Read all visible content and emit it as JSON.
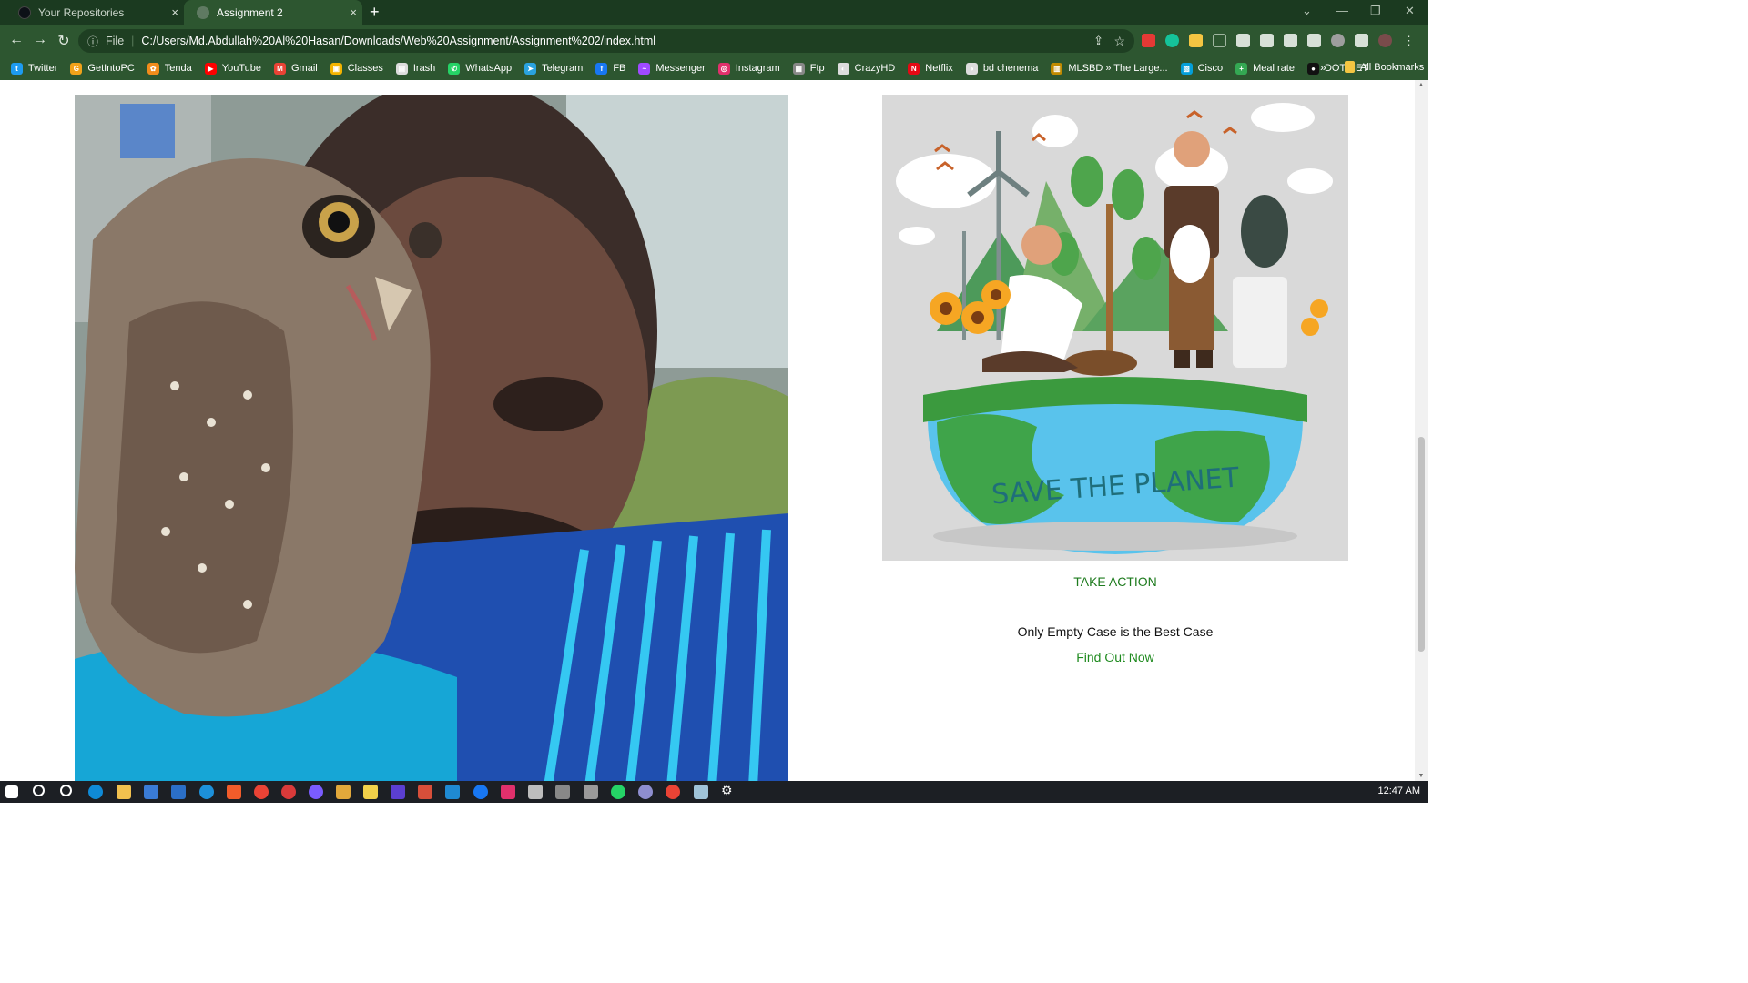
{
  "browser": {
    "tabs": [
      {
        "title": "Your Repositories",
        "active": false,
        "icon": "github-icon"
      },
      {
        "title": "Assignment 2",
        "active": true,
        "icon": "globe-icon"
      }
    ],
    "close_glyph": "×",
    "new_tab_glyph": "+",
    "address": {
      "scheme_label": "File",
      "url": "C:/Users/Md.Abdullah%20Al%20Hasan/Downloads/Web%20Assignment/Assignment%202/index.html"
    },
    "nav_glyphs": {
      "back": "←",
      "forward": "→",
      "reload": "↻"
    },
    "window_glyphs": {
      "chevron": "⌄",
      "minimize": "—",
      "restore": "❐",
      "close": "✕"
    },
    "bookmarks": [
      {
        "label": "Twitter",
        "icon": "twitter-icon",
        "color": "#1d9bf0",
        "glyph": "t"
      },
      {
        "label": "GetIntoPC",
        "icon": "getintopc-icon",
        "color": "#f0a21a",
        "glyph": "G"
      },
      {
        "label": "Tenda",
        "icon": "tenda-icon",
        "color": "#f28c1b",
        "glyph": "✿"
      },
      {
        "label": "YouTube",
        "icon": "youtube-icon",
        "color": "#ff0000",
        "glyph": "▶"
      },
      {
        "label": "Gmail",
        "icon": "gmail-icon",
        "color": "#ea4335",
        "glyph": "M"
      },
      {
        "label": "Classes",
        "icon": "classroom-icon",
        "color": "#f4b400",
        "glyph": "▣"
      },
      {
        "label": "Irash",
        "icon": "irash-icon",
        "color": "#dddddd",
        "glyph": "▤"
      },
      {
        "label": "WhatsApp",
        "icon": "whatsapp-icon",
        "color": "#25d366",
        "glyph": "✆"
      },
      {
        "label": "Telegram",
        "icon": "telegram-icon",
        "color": "#2aa3df",
        "glyph": "➤"
      },
      {
        "label": "FB",
        "icon": "facebook-icon",
        "color": "#1877f2",
        "glyph": "f"
      },
      {
        "label": "Messenger",
        "icon": "messenger-icon",
        "color": "#a04aff",
        "glyph": "~"
      },
      {
        "label": "Instagram",
        "icon": "instagram-icon",
        "color": "#e1306c",
        "glyph": "◎"
      },
      {
        "label": "Ftp",
        "icon": "ftp-icon",
        "color": "#888888",
        "glyph": "▦"
      },
      {
        "label": "CrazyHD",
        "icon": "crazyhd-icon",
        "color": "#dddddd",
        "glyph": "◐"
      },
      {
        "label": "Netflix",
        "icon": "netflix-icon",
        "color": "#e50914",
        "glyph": "N"
      },
      {
        "label": "bd chenema",
        "icon": "bdchenema-icon",
        "color": "#dddddd",
        "glyph": "◑"
      },
      {
        "label": "MLSBD » The Large...",
        "icon": "mlsbd-icon",
        "color": "#c08a00",
        "glyph": "▥"
      },
      {
        "label": "Cisco",
        "icon": "cisco-icon",
        "color": "#049fd9",
        "glyph": "▧"
      },
      {
        "label": "Meal rate",
        "icon": "mealrate-icon",
        "color": "#34a853",
        "glyph": "+"
      },
      {
        "label": "DOT NET",
        "icon": "dotnet-icon",
        "color": "#111111",
        "glyph": "●"
      }
    ],
    "bookmarks_overflow": "»",
    "all_bookmarks_label": "All Bookmarks"
  },
  "page": {
    "left_image_alt_icon": "owl-photo",
    "right_image_alt_icon": "save-the-planet-illustration",
    "illustration_text": "SAVE THE PLANET",
    "take_action": "TAKE ACTION",
    "tagline": "Only Empty Case is the Best Case",
    "find_out": "Find Out Now"
  },
  "taskbar": {
    "clock": "12:47 AM"
  },
  "colors": {
    "browser_frame": "#1b3a20",
    "toolbar": "#2d5630",
    "link_green": "#1e8a1e",
    "illustration_bg": "#d9d9d9"
  }
}
